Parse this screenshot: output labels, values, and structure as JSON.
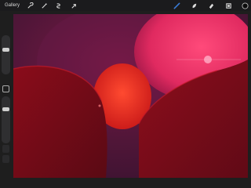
{
  "topbar": {
    "gallery_label": "Gallery",
    "left_tools": [
      "wrench-icon",
      "magic-wand-icon",
      "selection-icon",
      "transform-arrow-icon"
    ],
    "right_tools": [
      "brush-icon",
      "smudge-icon",
      "eraser-icon",
      "layers-icon",
      "color-swatch-icon"
    ]
  },
  "colors": {
    "active_tool": "#3a7bd5",
    "current_color": "#0b0b0b",
    "canvas_bg": "#4a1430"
  },
  "sidebar": {
    "brush_size_level": 0.35,
    "opacity_level": 0.25
  }
}
